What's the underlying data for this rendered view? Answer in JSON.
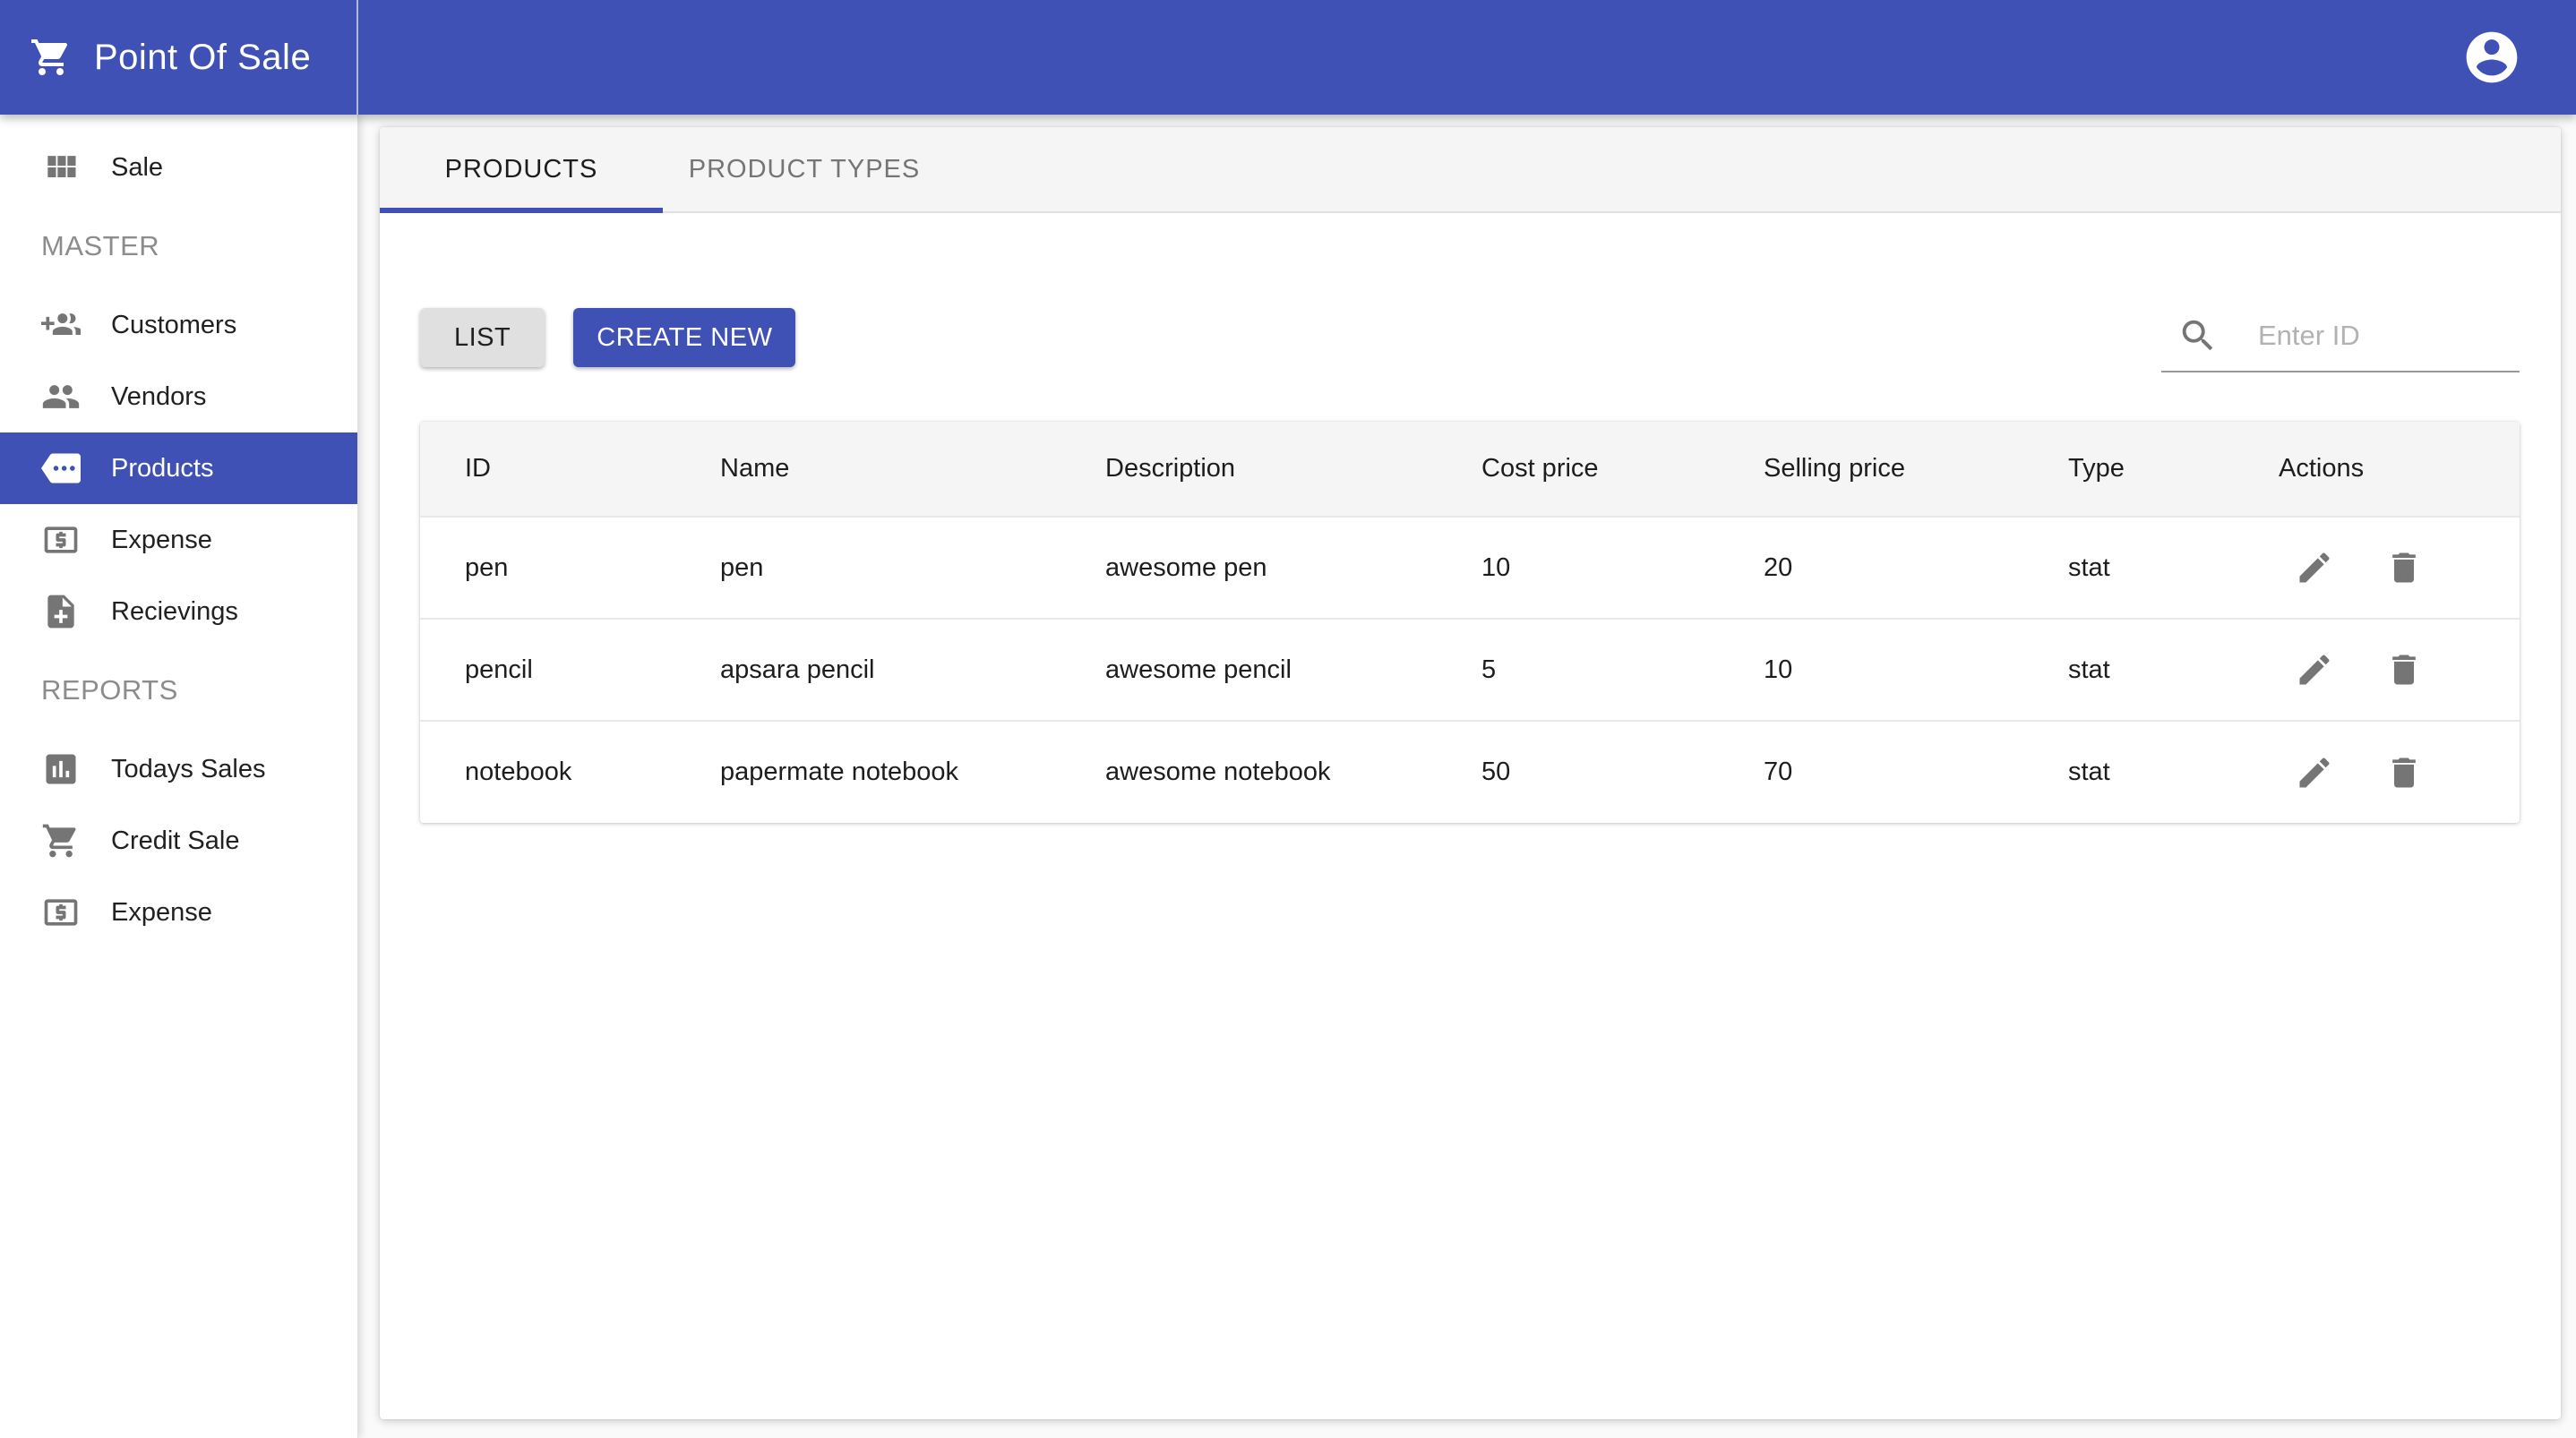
{
  "colors": {
    "primary": "#3f51b5",
    "page_bg": "#fafafa",
    "tabstrip_bg": "#f5f5f5",
    "table_header_bg": "#f5f5f5",
    "icon_gray": "#757575"
  },
  "header": {
    "title": "Point Of Sale",
    "logo_icon": "shopping-cart-icon",
    "account_icon": "account-circle-icon"
  },
  "sidebar": {
    "top_items": [
      {
        "label": "Sale",
        "icon": "grid-icon"
      }
    ],
    "sections": [
      {
        "heading": "MASTER",
        "items": [
          {
            "label": "Customers",
            "icon": "person-add-icon"
          },
          {
            "label": "Vendors",
            "icon": "people-icon"
          },
          {
            "label": "Products",
            "icon": "tag-icon",
            "active": true
          },
          {
            "label": "Expense",
            "icon": "money-icon"
          },
          {
            "label": "Recievings",
            "icon": "note-add-icon"
          }
        ]
      },
      {
        "heading": "REPORTS",
        "items": [
          {
            "label": "Todays Sales",
            "icon": "bar-chart-icon"
          },
          {
            "label": "Credit Sale",
            "icon": "shopping-cart-icon"
          },
          {
            "label": "Expense",
            "icon": "money-icon"
          }
        ]
      }
    ]
  },
  "tabs": [
    {
      "label": "PRODUCTS",
      "active": true
    },
    {
      "label": "PRODUCT TYPES",
      "active": false
    }
  ],
  "toolbar": {
    "list_label": "LIST",
    "create_label": "CREATE NEW",
    "search_placeholder": "Enter ID"
  },
  "table": {
    "columns": [
      "ID",
      "Name",
      "Description",
      "Cost price",
      "Selling price",
      "Type",
      "Actions"
    ],
    "rows": [
      {
        "id": "pen",
        "name": "pen",
        "description": "awesome pen",
        "cost_price": "10",
        "selling_price": "20",
        "type": "stat"
      },
      {
        "id": "pencil",
        "name": "apsara pencil",
        "description": "awesome pencil",
        "cost_price": "5",
        "selling_price": "10",
        "type": "stat"
      },
      {
        "id": "notebook",
        "name": "papermate notebook",
        "description": "awesome notebook",
        "cost_price": "50",
        "selling_price": "70",
        "type": "stat"
      }
    ]
  }
}
